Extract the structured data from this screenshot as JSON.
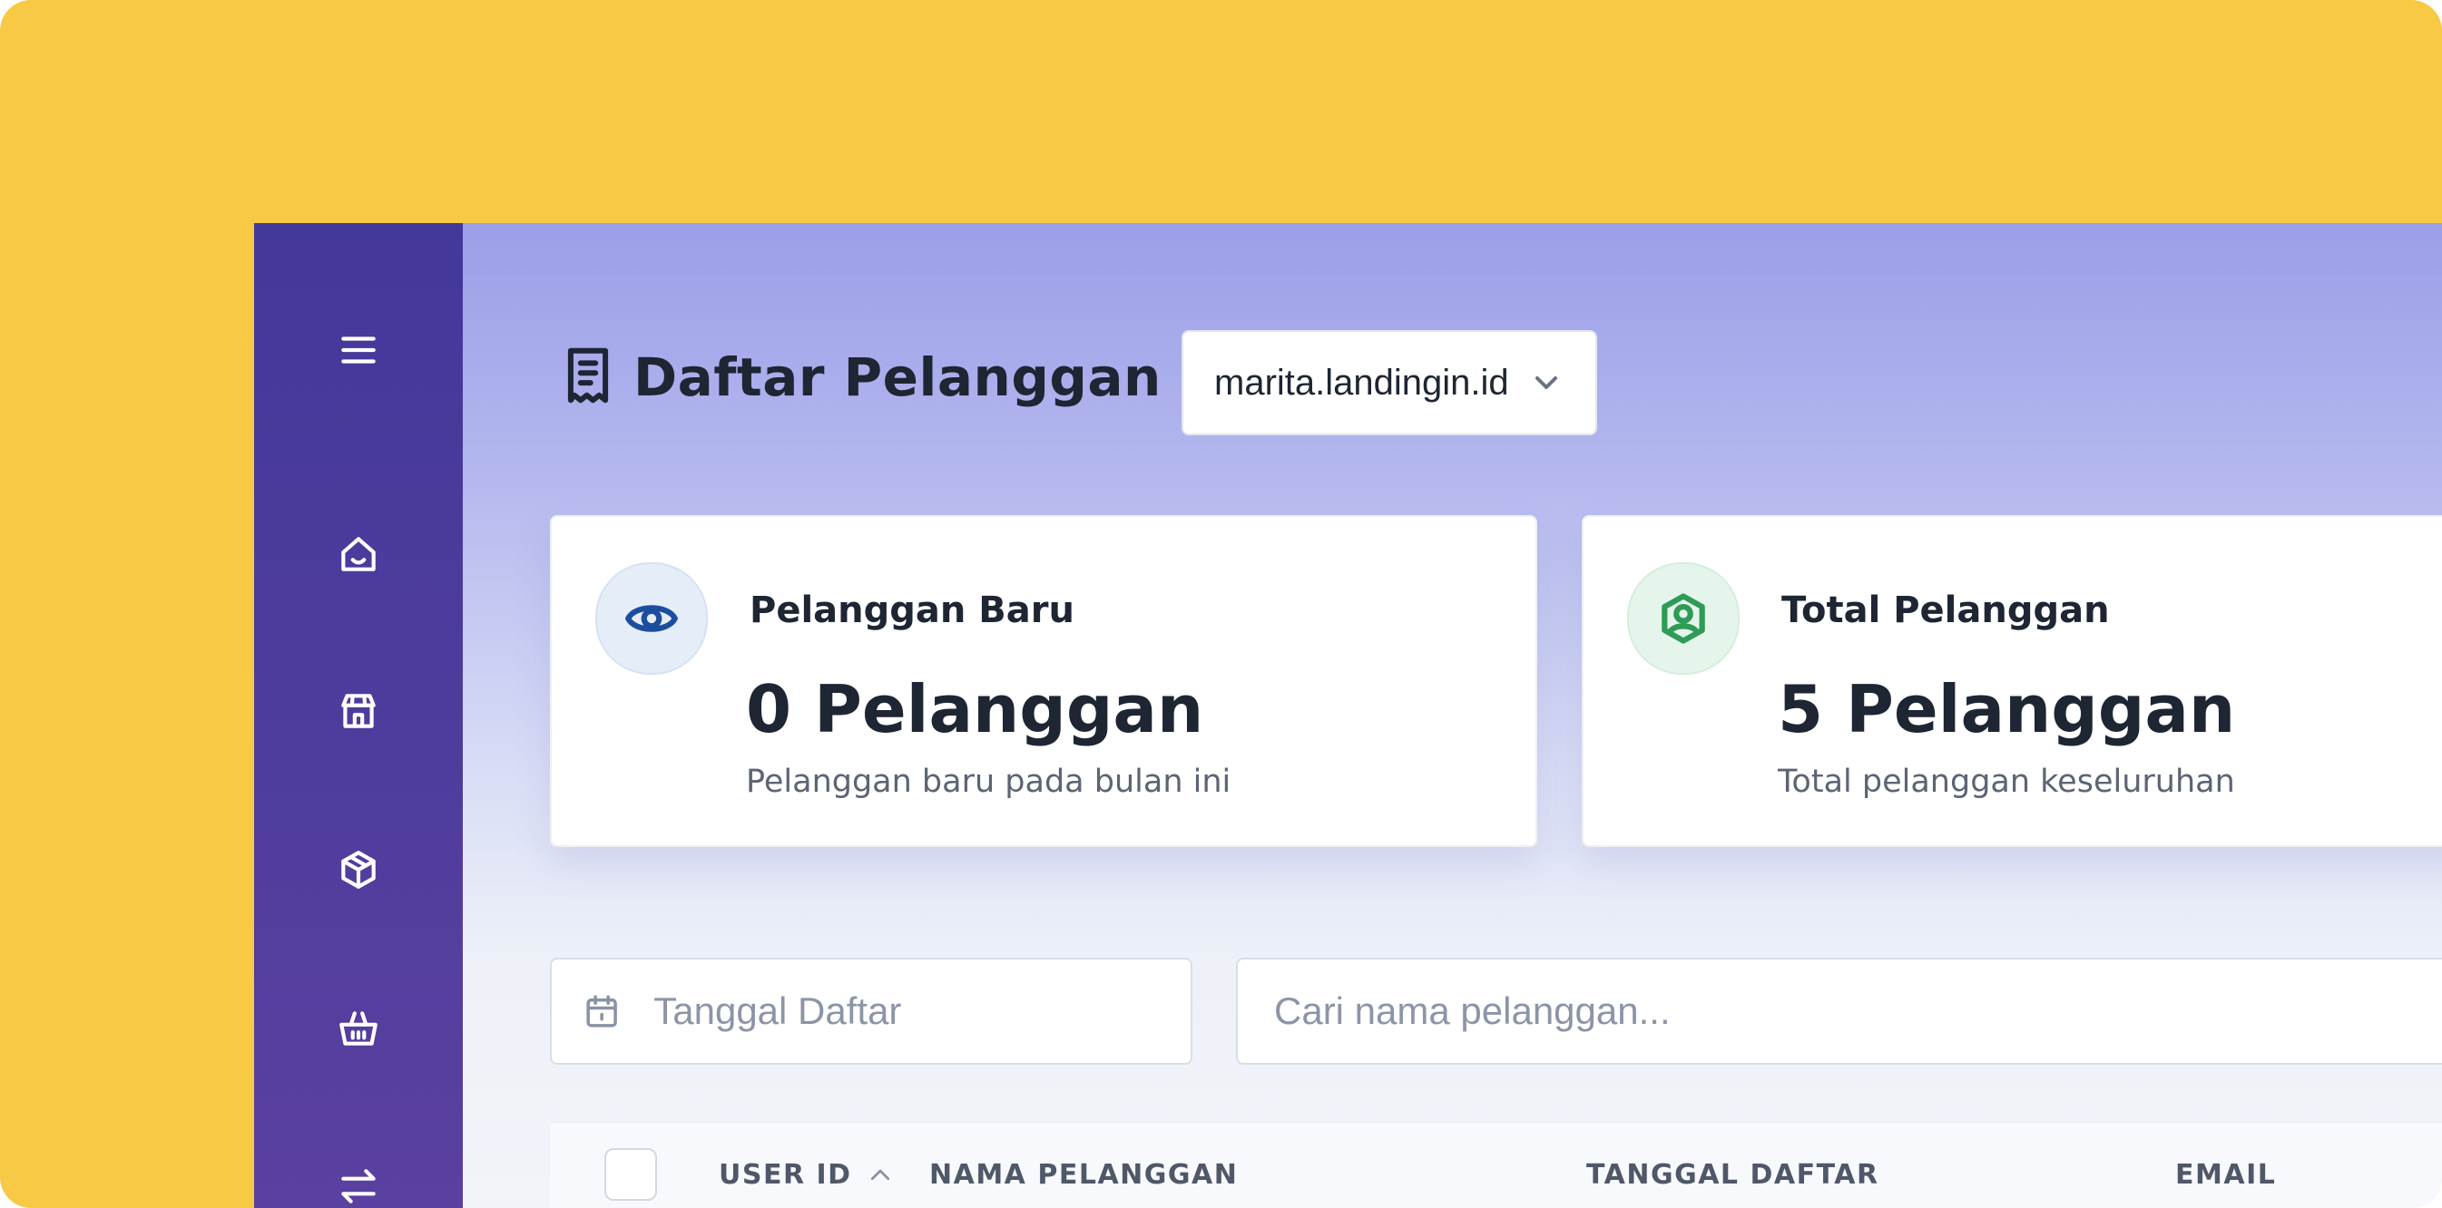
{
  "colors": {
    "background": "#F7C944",
    "sidebar": "#4A3A9C",
    "accent_blue": "#1D4E9E",
    "accent_green": "#2E9B57",
    "text_dark": "#1E2533"
  },
  "sidebar": {
    "items": [
      {
        "icon": "hamburger-menu-icon"
      },
      {
        "icon": "home-icon"
      },
      {
        "icon": "store-icon"
      },
      {
        "icon": "package-icon"
      },
      {
        "icon": "basket-icon"
      },
      {
        "icon": "transfer-arrows-icon"
      }
    ]
  },
  "header": {
    "title": "Daftar Pelanggan",
    "title_icon": "receipt-icon",
    "domain_select": {
      "value": "marita.landingin.id",
      "icon": "chevron-down-icon"
    }
  },
  "cards": [
    {
      "label": "Pelanggan Baru",
      "value": "0 Pelanggan",
      "subtitle": "Pelanggan baru pada bulan ini",
      "icon": "eye-icon"
    },
    {
      "label": "Total Pelanggan",
      "value": "5 Pelanggan",
      "subtitle": "Total pelanggan keseluruhan",
      "icon": "user-shield-icon"
    }
  ],
  "filters": {
    "date_placeholder": "Tanggal Daftar",
    "search_placeholder": "Cari nama pelanggan..."
  },
  "table": {
    "columns": [
      "USER ID",
      "NAMA PELANGGAN",
      "TANGGAL DAFTAR",
      "EMAIL"
    ]
  }
}
